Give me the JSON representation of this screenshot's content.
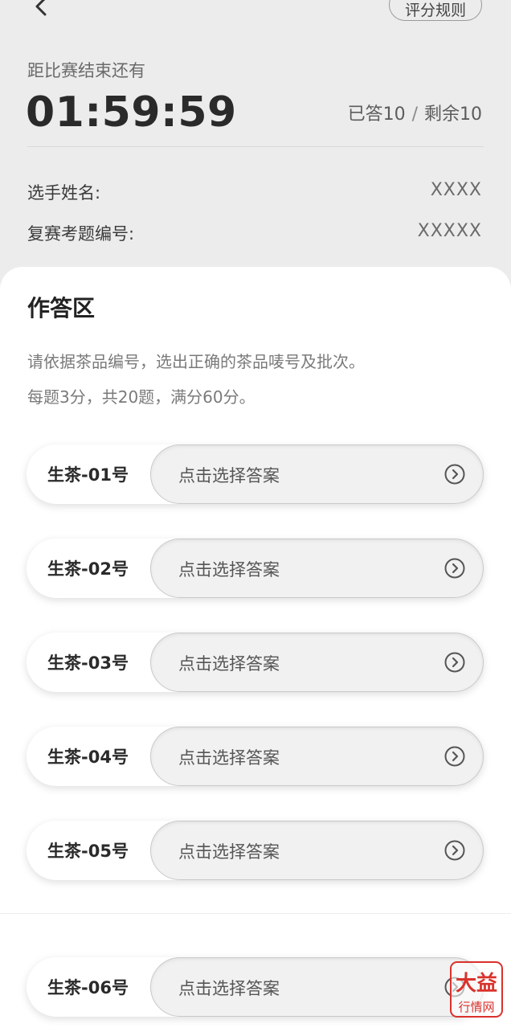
{
  "header": {
    "back_icon": "chevron-left-icon",
    "rules_button": "评分规则"
  },
  "countdown": {
    "label": "距比赛结束还有",
    "time": "01:59:59"
  },
  "progress": {
    "answered": "已答10",
    "separator": "/",
    "remaining": "剩余10"
  },
  "info": {
    "name_label": "选手姓名:",
    "name_value": "XXXX",
    "id_label": "复赛考题编号:",
    "id_value": "XXXXX"
  },
  "answer_area": {
    "title": "作答区",
    "instruction": "请依据茶品编号，选出正确的茶品唛号及批次。",
    "scoring": "每题3分，共20题，满分60分。",
    "questions": [
      {
        "label": "生茶-01号",
        "placeholder": "点击选择答案"
      },
      {
        "label": "生茶-02号",
        "placeholder": "点击选择答案"
      },
      {
        "label": "生茶-03号",
        "placeholder": "点击选择答案"
      },
      {
        "label": "生茶-04号",
        "placeholder": "点击选择答案"
      },
      {
        "label": "生茶-05号",
        "placeholder": "点击选择答案"
      },
      {
        "label": "生茶-06号",
        "placeholder": "点击选择答案"
      }
    ],
    "arrow_icon": "circle-chevron-right-icon"
  },
  "watermark": {
    "top": "大益",
    "bottom": "行情网",
    "color": "#d9322b"
  },
  "colors": {
    "background": "#ececec",
    "panel": "#ffffff",
    "text": "#2b2b2b"
  }
}
